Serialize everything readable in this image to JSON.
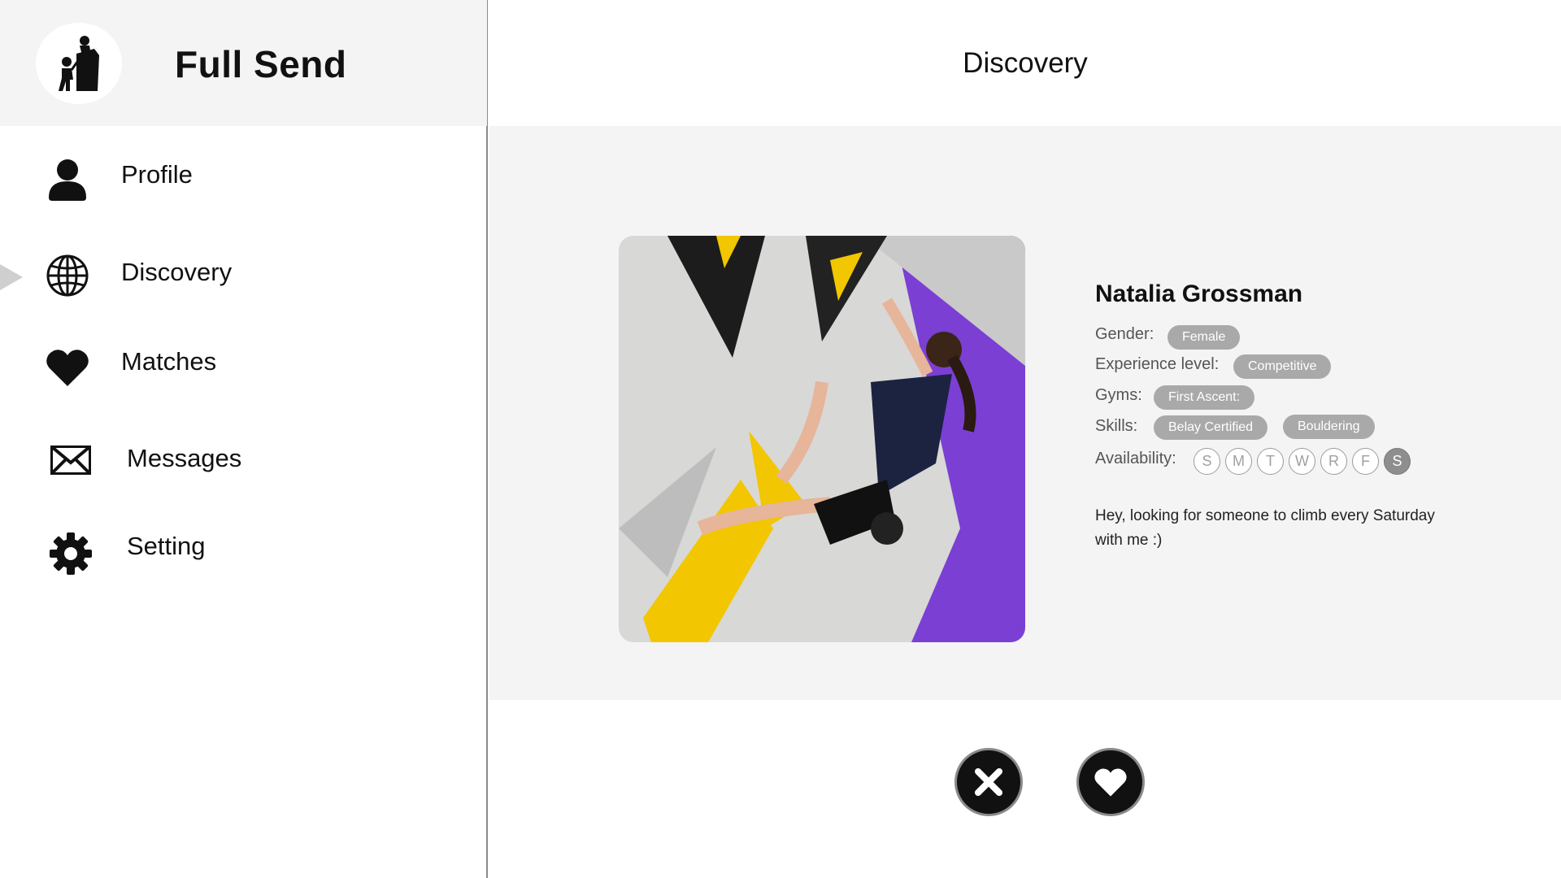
{
  "app": {
    "name": "Full Send",
    "logo_icon": "climbing-partners-icon"
  },
  "sidebar": {
    "items": [
      {
        "label": "Profile",
        "icon": "user-icon",
        "active": false
      },
      {
        "label": "Discovery",
        "icon": "globe-icon",
        "active": true
      },
      {
        "label": "Matches",
        "icon": "heart-icon",
        "active": false
      },
      {
        "label": "Messages",
        "icon": "envelope-icon",
        "active": false
      },
      {
        "label": "Setting",
        "icon": "gear-icon",
        "active": false
      }
    ]
  },
  "header": {
    "title": "Discovery"
  },
  "profile": {
    "name": "Natalia Grossman",
    "photo_alt": "climber-photo",
    "gender_label": "Gender:",
    "gender": "Female",
    "experience_label": "Experience level:",
    "experience": "Competitive",
    "gyms_label": "Gyms:",
    "gyms": [
      "First Ascent:"
    ],
    "skills_label": "Skills:",
    "skills": [
      "Belay Certified",
      "Bouldering"
    ],
    "availability_label": "Availability:",
    "availability": [
      {
        "day": "S",
        "available": false
      },
      {
        "day": "M",
        "available": false
      },
      {
        "day": "T",
        "available": false
      },
      {
        "day": "W",
        "available": false
      },
      {
        "day": "R",
        "available": false
      },
      {
        "day": "F",
        "available": false
      },
      {
        "day": "S",
        "available": true
      }
    ],
    "bio": "Hey, looking for someone to climb every Saturday with me :)"
  },
  "actions": {
    "reject_icon": "close-icon",
    "like_icon": "heart-icon"
  },
  "colors": {
    "sidebar_header_bg": "#f4f4f4",
    "content_bg": "#f4f4f4",
    "tag_bg": "#a9a9a9",
    "action_bg": "#111111",
    "photo_accent": "#7b3fd4"
  }
}
